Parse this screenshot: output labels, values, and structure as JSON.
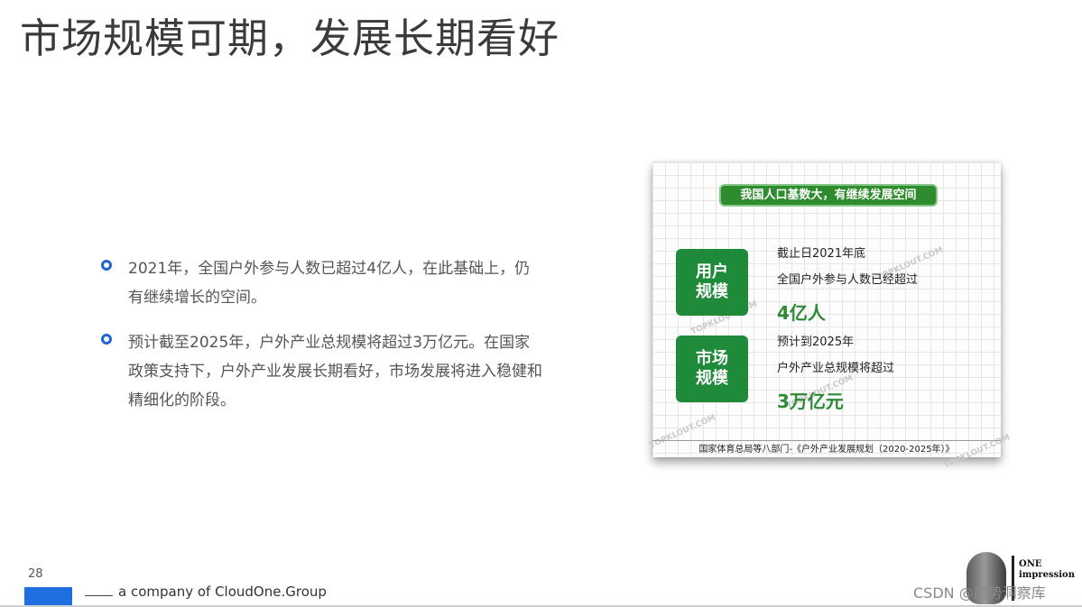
{
  "slide": {
    "title": "市场规模可期，发展长期看好",
    "bullets": [
      "2021年，全国户外参与人数已超过4亿人，在此基础上，仍有继续增长的空间。",
      "预计截至2025年，户外产业总规模将超过3万亿元。在国家政策支持下，户外产业发展长期看好，市场发展将进入稳健和精细化的阶段。"
    ]
  },
  "infographic": {
    "banner": "我国人口基数大，有继续发展空间",
    "users": {
      "label": "用户规模",
      "line1": "截止日2021年底",
      "line2": "全国户外参与人数已经超过",
      "value": "4亿人"
    },
    "market": {
      "label": "市场规模",
      "line1": "预计到2025年",
      "line2": "户外产业总规模将超过",
      "value": "3万亿元"
    },
    "source": "国家体育总局等八部门-《户外产业发展规划（2020-2025年）》",
    "watermark": "TOPKLOUT.COM"
  },
  "footer": {
    "page_number": "28",
    "tagline": "a company of CloudOne.Group",
    "logo_line1": "ONE",
    "logo_line2": "impression",
    "csdn_watermark": "CSDN @趋势洞察库"
  },
  "colors": {
    "accent_blue": "#1f6fe0",
    "bullet_blue": "#2264d1",
    "infographic_green": "#1f8a3a",
    "value_green": "#2e8a35"
  }
}
